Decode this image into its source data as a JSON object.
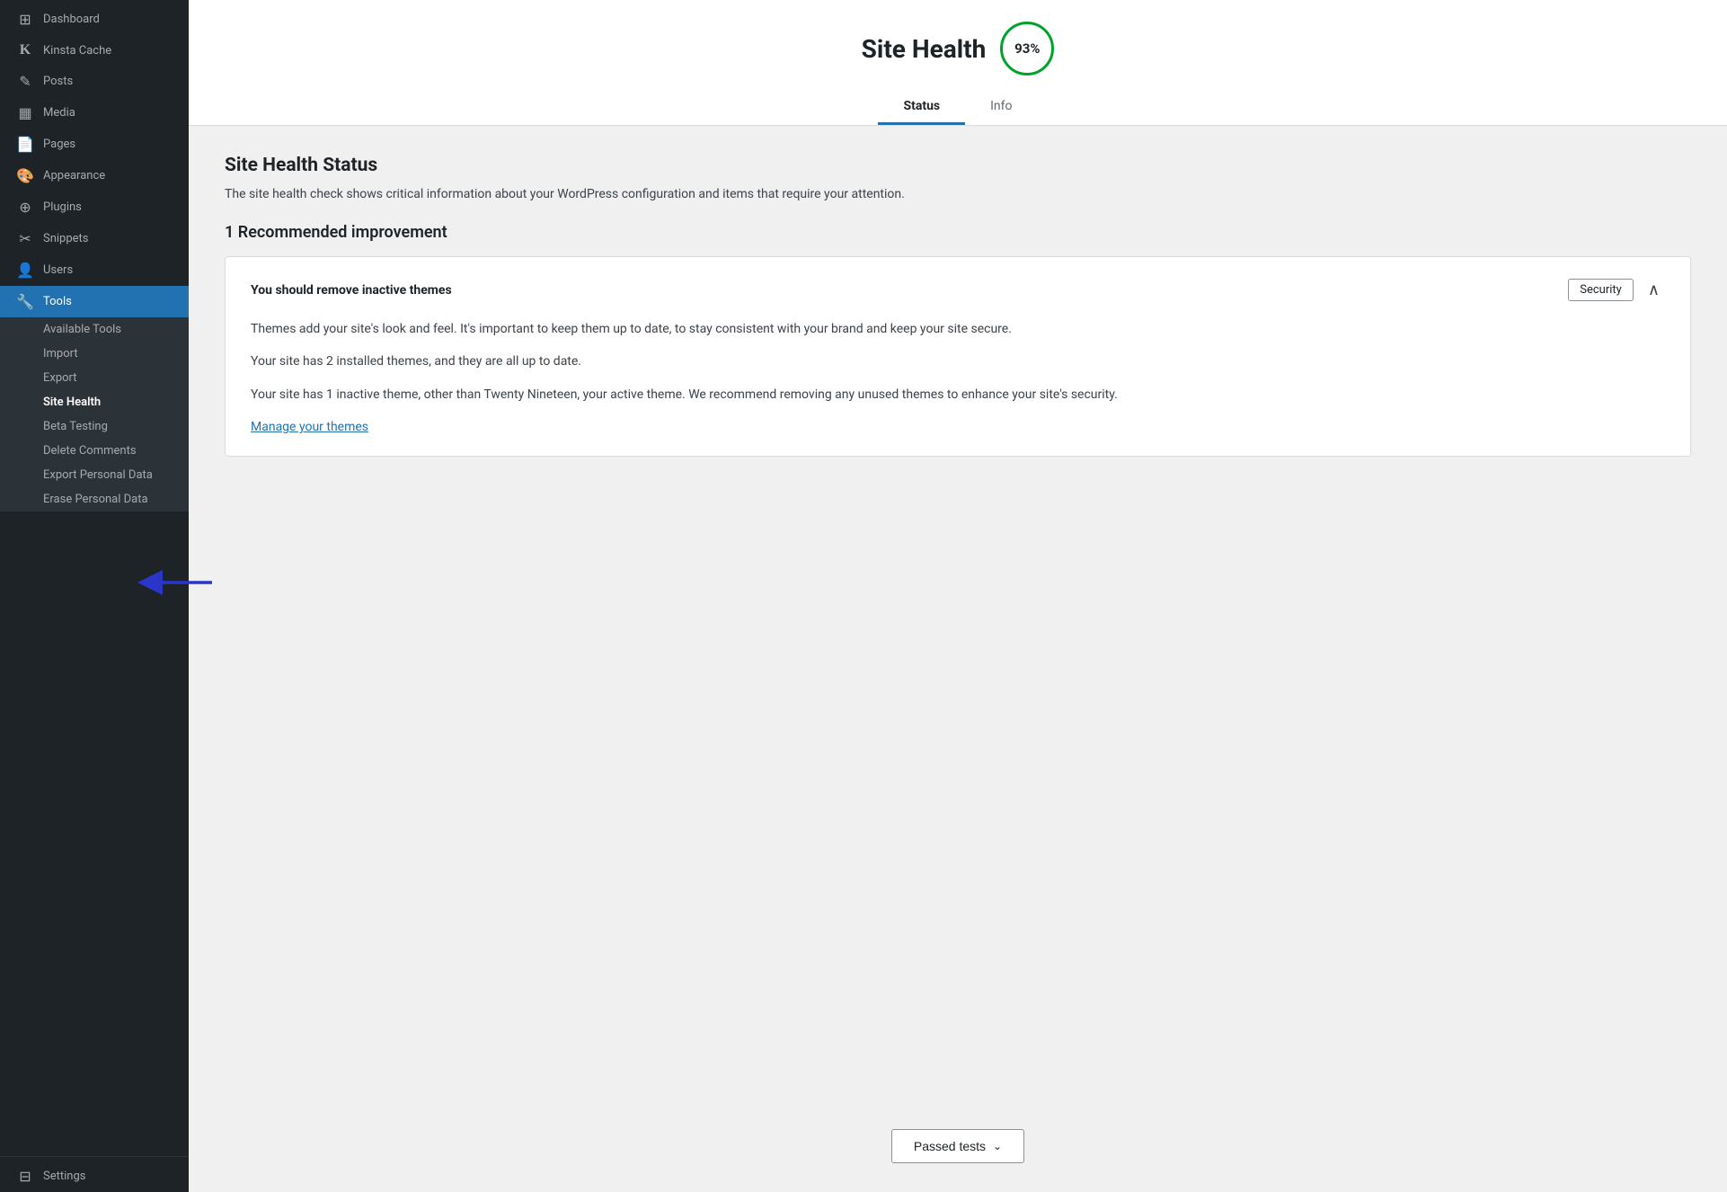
{
  "sidebar": {
    "items": [
      {
        "id": "dashboard",
        "label": "Dashboard",
        "icon": "⊞",
        "active": false
      },
      {
        "id": "kinsta-cache",
        "label": "Kinsta Cache",
        "icon": "K",
        "active": false
      },
      {
        "id": "posts",
        "label": "Posts",
        "icon": "✏",
        "active": false
      },
      {
        "id": "media",
        "label": "Media",
        "icon": "⊡",
        "active": false
      },
      {
        "id": "pages",
        "label": "Pages",
        "icon": "📄",
        "active": false
      },
      {
        "id": "appearance",
        "label": "Appearance",
        "icon": "🎨",
        "active": false
      },
      {
        "id": "plugins",
        "label": "Plugins",
        "icon": "🔌",
        "active": false
      },
      {
        "id": "snippets",
        "label": "Snippets",
        "icon": "⚙",
        "active": false
      },
      {
        "id": "users",
        "label": "Users",
        "icon": "👤",
        "active": false
      },
      {
        "id": "tools",
        "label": "Tools",
        "icon": "🔧",
        "active": true
      }
    ],
    "submenu": [
      {
        "id": "available-tools",
        "label": "Available Tools",
        "active": false
      },
      {
        "id": "import",
        "label": "Import",
        "active": false
      },
      {
        "id": "export",
        "label": "Export",
        "active": false
      },
      {
        "id": "site-health",
        "label": "Site Health",
        "active": true
      },
      {
        "id": "beta-testing",
        "label": "Beta Testing",
        "active": false
      },
      {
        "id": "delete-comments",
        "label": "Delete Comments",
        "active": false
      },
      {
        "id": "export-personal-data",
        "label": "Export Personal Data",
        "active": false
      },
      {
        "id": "erase-personal-data",
        "label": "Erase Personal Data",
        "active": false
      }
    ],
    "settings": {
      "id": "settings",
      "label": "Settings",
      "icon": "⊟"
    }
  },
  "header": {
    "title": "Site Health",
    "score": "93%",
    "tabs": [
      {
        "id": "status",
        "label": "Status",
        "active": true
      },
      {
        "id": "info",
        "label": "Info",
        "active": false
      }
    ]
  },
  "content": {
    "section_title": "Site Health Status",
    "section_description": "The site health check shows critical information about your WordPress configuration and items that require your attention.",
    "recommendation_title": "1 Recommended improvement",
    "card": {
      "title": "You should remove inactive themes",
      "badge": "Security",
      "body": [
        "Themes add your site's look and feel. It's important to keep them up to date, to stay consistent with your brand and keep your site secure.",
        "Your site has 2 installed themes, and they are all up to date.",
        "Your site has 1 inactive theme, other than Twenty Nineteen, your active theme. We recommend removing any unused themes to enhance your site's security."
      ],
      "link_text": "Manage your themes"
    },
    "passed_tests_label": "Passed tests",
    "passed_tests_chevron": "∨"
  }
}
